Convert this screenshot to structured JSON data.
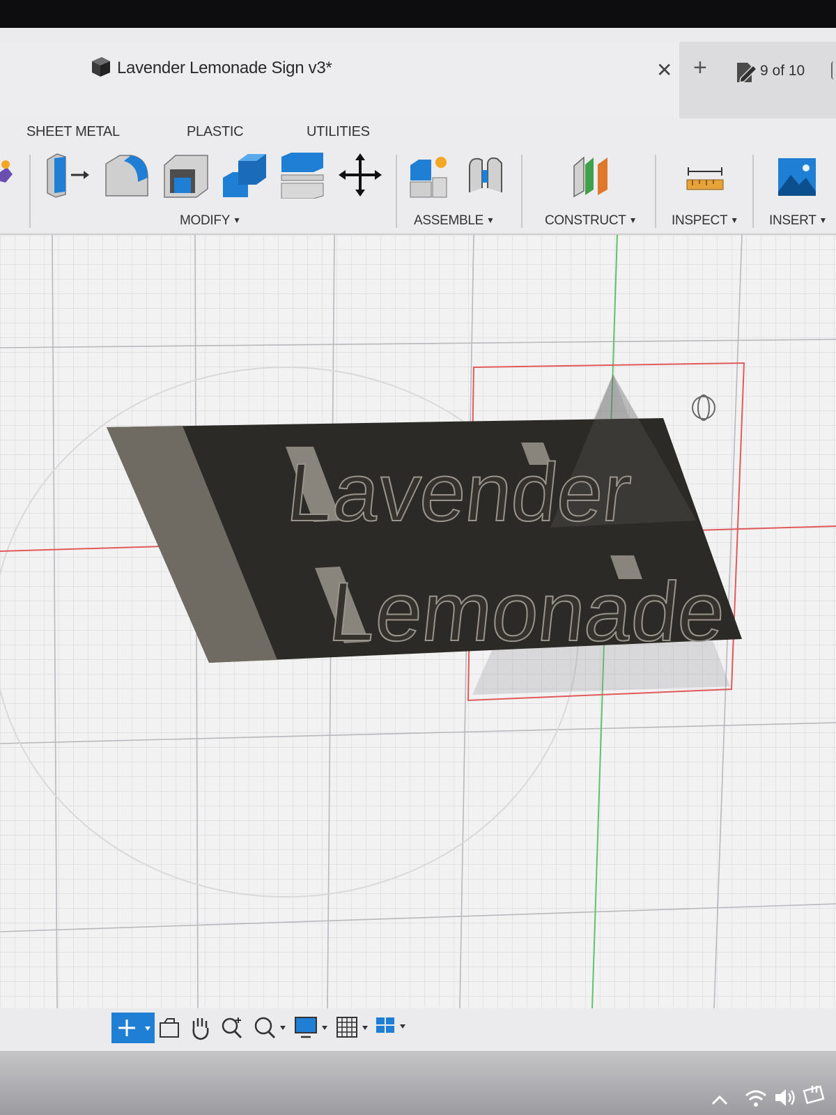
{
  "document": {
    "title": "Lavender Lemonade Sign v3*",
    "version_counter": "9 of 10"
  },
  "workspace_tabs": [
    "SHEET METAL",
    "PLASTIC",
    "UTILITIES"
  ],
  "toolbar_groups": {
    "modify": "MODIFY",
    "assemble": "ASSEMBLE",
    "construct": "CONSTRUCT",
    "inspect": "INSPECT",
    "insert": "INSERT"
  },
  "model_text": {
    "line1": "Lavender",
    "line2": "Lemonade"
  },
  "icons": {
    "tools": [
      "create-icon",
      "press-pull-icon",
      "fillet-icon",
      "shell-icon",
      "combine-icon",
      "replace-face-icon",
      "move-icon",
      "new-component-icon",
      "joint-icon",
      "offset-plane-icon",
      "measure-icon",
      "insert-image-icon"
    ],
    "nav": [
      "orbit-icon",
      "look-at-icon",
      "pan-icon",
      "zoom-icon",
      "fit-icon",
      "display-settings-icon",
      "grid-settings-icon",
      "viewports-icon"
    ],
    "system": [
      "chevron-up-icon",
      "wifi-icon",
      "volume-icon",
      "battery-icon"
    ]
  },
  "colors": {
    "accent_blue": "#1f7fd4",
    "sign_body": "#2c2a26",
    "grid_line": "#c4c4c8",
    "x_axis": "#e05a5a",
    "y_axis": "#5cc46a"
  }
}
